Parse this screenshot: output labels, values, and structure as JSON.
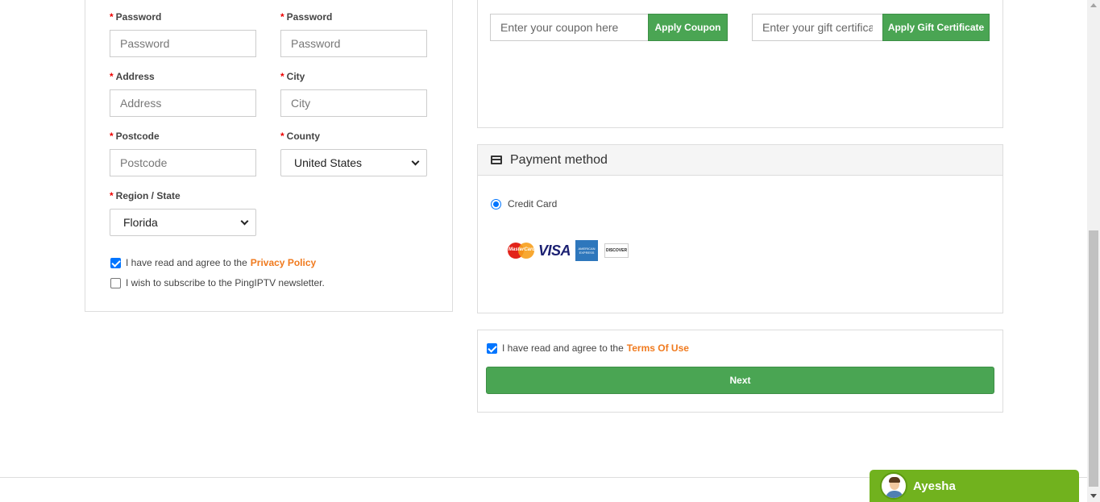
{
  "form": {
    "password": {
      "label": "Password",
      "placeholder": "Password"
    },
    "confirm_password": {
      "label": "Password",
      "placeholder": "Password"
    },
    "address": {
      "label": "Address",
      "placeholder": "Address"
    },
    "city": {
      "label": "City",
      "placeholder": "City"
    },
    "postcode": {
      "label": "Postcode",
      "placeholder": "Postcode"
    },
    "county": {
      "label": "County",
      "value": "United States"
    },
    "region": {
      "label": "Region / State",
      "value": "Florida"
    },
    "required_mark": "*",
    "privacy": {
      "text": "I have read and agree to the",
      "link": "Privacy Policy",
      "checked": true
    },
    "newsletter": {
      "text": "I wish to subscribe to the PingIPTV newsletter.",
      "checked": false
    }
  },
  "coupon": {
    "placeholder": "Enter your coupon here",
    "button": "Apply Coupon"
  },
  "gift": {
    "placeholder": "Enter your gift certificate",
    "button": "Apply Gift Certificate"
  },
  "payment": {
    "title": "Payment method",
    "option": "Credit Card",
    "cards": {
      "mastercard": "MasterCard",
      "visa": "VISA",
      "amex": "AMERICAN EXPRESS",
      "discover": "DISCOVER"
    }
  },
  "terms": {
    "text": "I have read and agree to the",
    "link": "Terms Of Use",
    "checked": true,
    "next_button": "Next"
  },
  "chat": {
    "agent_name": "Ayesha"
  },
  "colors": {
    "accent_green": "#4aa553",
    "link_orange": "#f07a1e",
    "chat_green": "#71b21e"
  }
}
